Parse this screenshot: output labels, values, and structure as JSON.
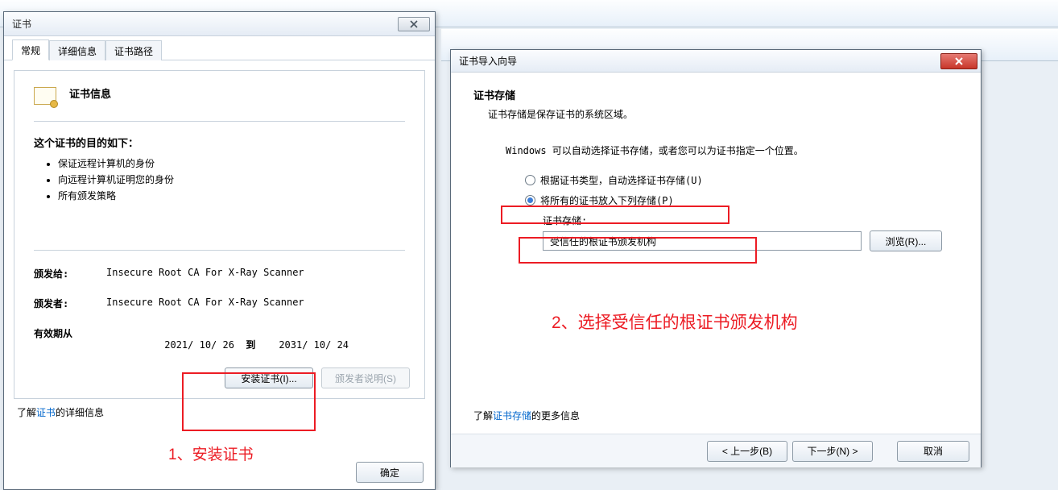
{
  "cert_dialog": {
    "title": "证书",
    "tabs": {
      "general": "常规",
      "details": "详细信息",
      "path": "证书路径"
    },
    "info_title": "证书信息",
    "purpose_title": "这个证书的目的如下：",
    "purposes": [
      "保证远程计算机的身份",
      "向远程计算机证明您的身份",
      "所有颁发策略"
    ],
    "issued_to_label": "颁发给:",
    "issued_to_value": "Insecure Root CA For X-Ray Scanner",
    "issued_by_label": "颁发者:",
    "issued_by_value": "Insecure Root CA For X-Ray Scanner",
    "valid_label": "有效期从",
    "valid_from": "2021/ 10/ 26",
    "valid_to_word": "到",
    "valid_to": "2031/ 10/ 24",
    "install_btn": "安装证书(I)...",
    "issuer_stmt_btn": "颁发者说明(S)",
    "learn_prefix": "了解",
    "learn_link": "证书",
    "learn_suffix": "的详细信息",
    "ok_btn": "确定"
  },
  "wizard": {
    "title": "证书导入向导",
    "heading": "证书存储",
    "sub": "证书存储是保存证书的系统区域。",
    "instr": "Windows 可以自动选择证书存储，或者您可以为证书指定一个位置。",
    "radio_auto": "根据证书类型，自动选择证书存储(U)",
    "radio_place": "将所有的证书放入下列存储(P)",
    "store_label": "证书存储:",
    "store_value": "受信任的根证书颁发机构",
    "browse_btn": "浏览(R)...",
    "learn_prefix": "了解",
    "learn_link": "证书存储",
    "learn_suffix": "的更多信息",
    "back_btn": "< 上一步(B)",
    "next_btn": "下一步(N) >",
    "cancel_btn": "取消"
  },
  "annotations": {
    "step1": "1、安装证书",
    "step2": "2、选择受信任的根证书颁发机构"
  }
}
